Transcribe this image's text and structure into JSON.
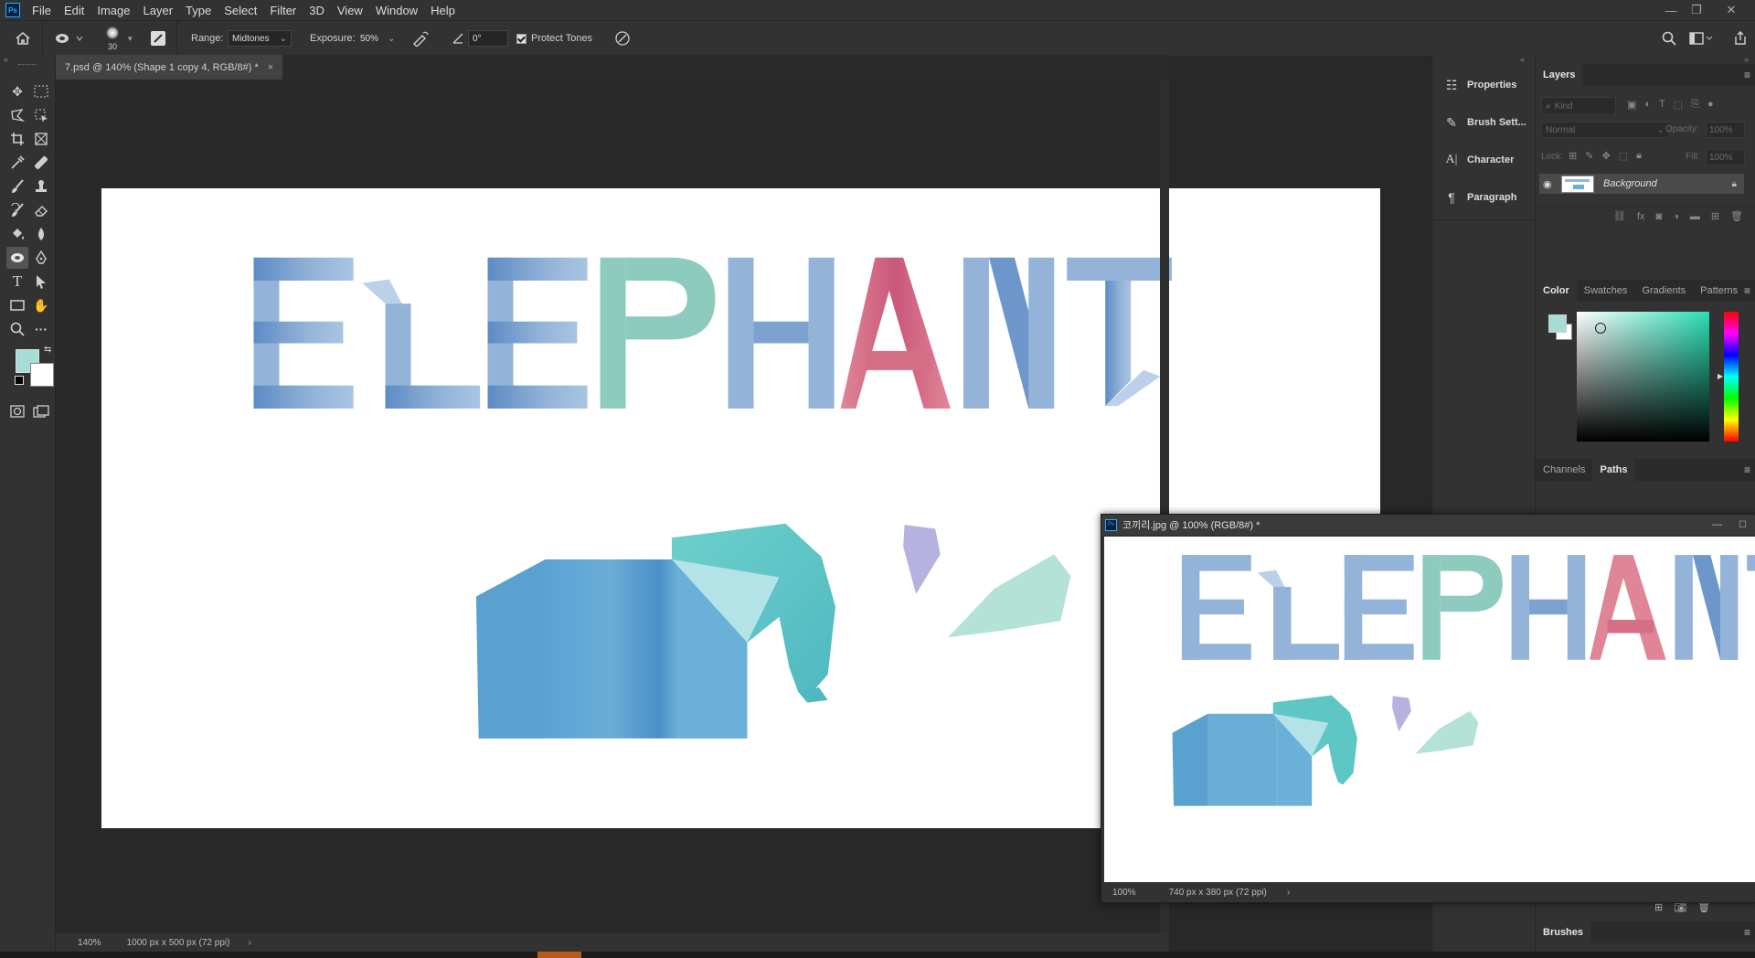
{
  "menubar": {
    "app_icon": "Ps",
    "items": [
      "File",
      "Edit",
      "Image",
      "Layer",
      "Type",
      "Select",
      "Filter",
      "3D",
      "View",
      "Window",
      "Help"
    ]
  },
  "options": {
    "brush_size": "30",
    "range_label": "Range:",
    "range_value": "Midtones",
    "exposure_label": "Exposure:",
    "exposure_value": "50%",
    "angle_value": "0°",
    "protect_tones": "Protect Tones"
  },
  "document": {
    "tab_title": "7.psd @ 140% (Shape 1 copy 4, RGB/8#) *",
    "zoom": "140%",
    "size": "1000 px x 500 px (72 ppi)",
    "artwork_text": "ELEPHANT"
  },
  "float_window": {
    "title": "코끼리.jpg @ 100% (RGB/8#) *",
    "zoom": "100%",
    "size": "740 px x 380 px (72 ppi)"
  },
  "icon_panels": [
    {
      "label": "Properties",
      "icon": "properties-icon"
    },
    {
      "label": "Brush Sett...",
      "icon": "brush-settings-icon"
    },
    {
      "label": "Character",
      "icon": "character-icon"
    },
    {
      "label": "Paragraph",
      "icon": "paragraph-icon"
    }
  ],
  "layers": {
    "tab": "Layers",
    "kind_placeholder": "Kind",
    "blend_mode": "Normal",
    "opacity_label": "Opacity:",
    "opacity_value": "100%",
    "lock_label": "Lock:",
    "fill_label": "Fill:",
    "fill_value": "100%",
    "items": [
      {
        "name": "Background",
        "visible": true,
        "locked": true
      }
    ]
  },
  "color_panel": {
    "tabs": [
      "Color",
      "Swatches",
      "Gradients",
      "Patterns"
    ],
    "foreground": "#a9dcd6",
    "background": "#ffffff"
  },
  "paths_panel": {
    "tabs": [
      "Channels",
      "Paths"
    ]
  },
  "brushes_panel": {
    "tab": "Brushes"
  },
  "colors": {
    "letter_blue": "#93b4d8",
    "letter_green": "#8ecbbf",
    "letter_pink": "#e08597",
    "elephant_body": "#6aaed6",
    "elephant_head": "#6ed0cc"
  }
}
